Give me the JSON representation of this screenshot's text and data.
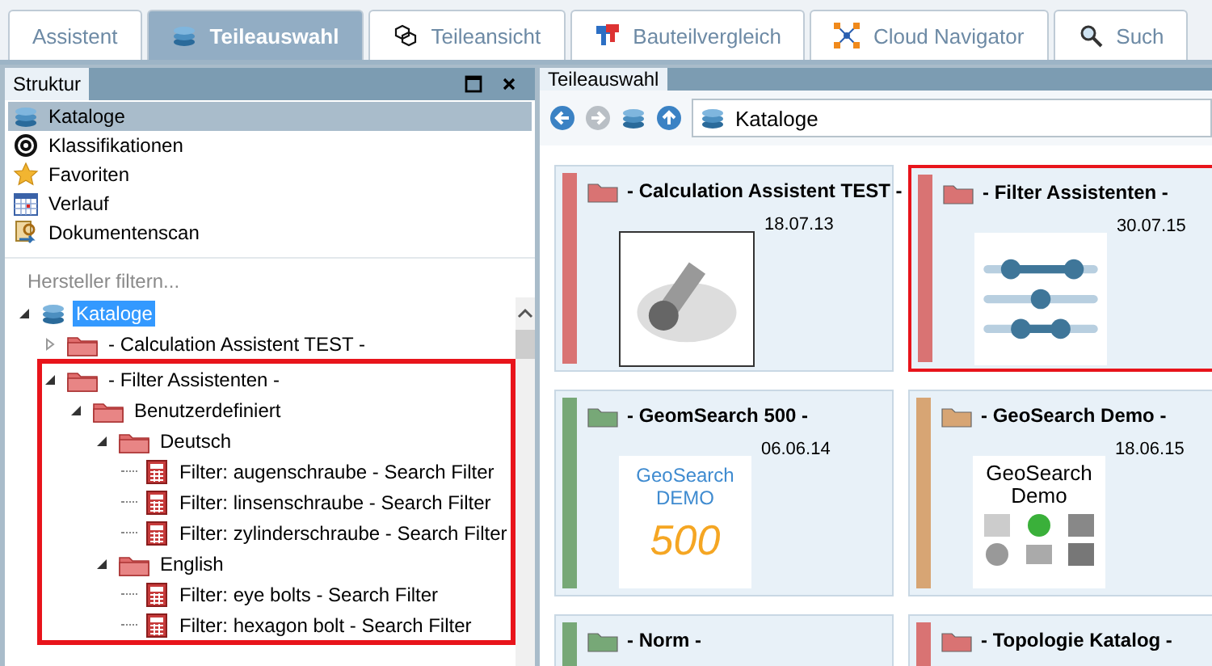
{
  "tabs": [
    {
      "label": "Assistent",
      "selected": false
    },
    {
      "label": "Teileauswahl",
      "selected": true
    },
    {
      "label": "Teileansicht",
      "selected": false
    },
    {
      "label": "Bauteilvergleich",
      "selected": false
    },
    {
      "label": "Cloud Navigator",
      "selected": false
    },
    {
      "label": "Such",
      "selected": false
    }
  ],
  "structure_panel": {
    "title": "Struktur",
    "nav_items": [
      {
        "label": "Kataloge",
        "selected": true
      },
      {
        "label": "Klassifikationen",
        "selected": false
      },
      {
        "label": "Favoriten",
        "selected": false
      },
      {
        "label": "Verlauf",
        "selected": false
      },
      {
        "label": "Dokumentenscan",
        "selected": false
      }
    ],
    "filter": {
      "placeholder": "Hersteller filtern..."
    },
    "tree": [
      {
        "label": "Kataloge",
        "kind": "catalog",
        "selected": true,
        "expanded": true,
        "highlighted": false,
        "children": [
          {
            "label": "- Calculation Assistent TEST -",
            "kind": "folder",
            "selected": false,
            "expanded": false,
            "highlighted": false
          },
          {
            "label": "- Filter Assistenten -",
            "kind": "folder",
            "selected": false,
            "expanded": true,
            "highlighted": true,
            "children": [
              {
                "label": "Benutzerdefiniert",
                "kind": "folder",
                "selected": false,
                "expanded": true,
                "highlighted": false,
                "children": [
                  {
                    "label": "Deutsch",
                    "kind": "folder",
                    "selected": false,
                    "expanded": true,
                    "highlighted": false,
                    "children": [
                      {
                        "label": "Filter: augenschraube - Search Filter",
                        "kind": "filter",
                        "selected": false,
                        "highlighted": false
                      },
                      {
                        "label": "Filter: linsenschraube - Search Filter",
                        "kind": "filter",
                        "selected": false,
                        "highlighted": false
                      },
                      {
                        "label": "Filter: zylinderschraube - Search Filter",
                        "kind": "filter",
                        "selected": false,
                        "highlighted": false
                      }
                    ]
                  },
                  {
                    "label": "English",
                    "kind": "folder",
                    "selected": false,
                    "expanded": true,
                    "highlighted": false,
                    "children": [
                      {
                        "label": "Filter: eye bolts - Search Filter",
                        "kind": "filter",
                        "selected": false,
                        "highlighted": false
                      },
                      {
                        "label": "Filter: hexagon bolt - Search Filter",
                        "kind": "filter",
                        "selected": false,
                        "highlighted": false
                      }
                    ]
                  }
                ]
              }
            ]
          }
        ]
      }
    ]
  },
  "parts_panel": {
    "title": "Teileauswahl",
    "path": "Kataloge",
    "cards": [
      {
        "title": "- Calculation Assistent TEST -",
        "date": "18.07.13",
        "color": "#d97373",
        "highlighted": false,
        "thumb": {
          "kind": "bolt"
        }
      },
      {
        "title": "- Filter Assistenten -",
        "date": "30.07.15",
        "color": "#d97373",
        "highlighted": true,
        "thumb": {
          "kind": "sliders"
        }
      },
      {
        "title": "- GeomSearch 500 -",
        "date": "06.06.14",
        "color": "#77a877",
        "highlighted": false,
        "thumb": {
          "kind": "logo",
          "lines": [
            "GeoSearch",
            "DEMO",
            "500"
          ]
        }
      },
      {
        "title": "- GeoSearch Demo -",
        "date": "18.06.15",
        "color": "#d7a574",
        "highlighted": false,
        "thumb": {
          "kind": "parts",
          "lines": [
            "GeoSearch",
            "Demo"
          ]
        }
      },
      {
        "title": "- Norm -",
        "color": "#77a877",
        "highlighted": false
      },
      {
        "title": "- Topologie Katalog -",
        "color": "#d97373",
        "highlighted": false
      }
    ]
  }
}
